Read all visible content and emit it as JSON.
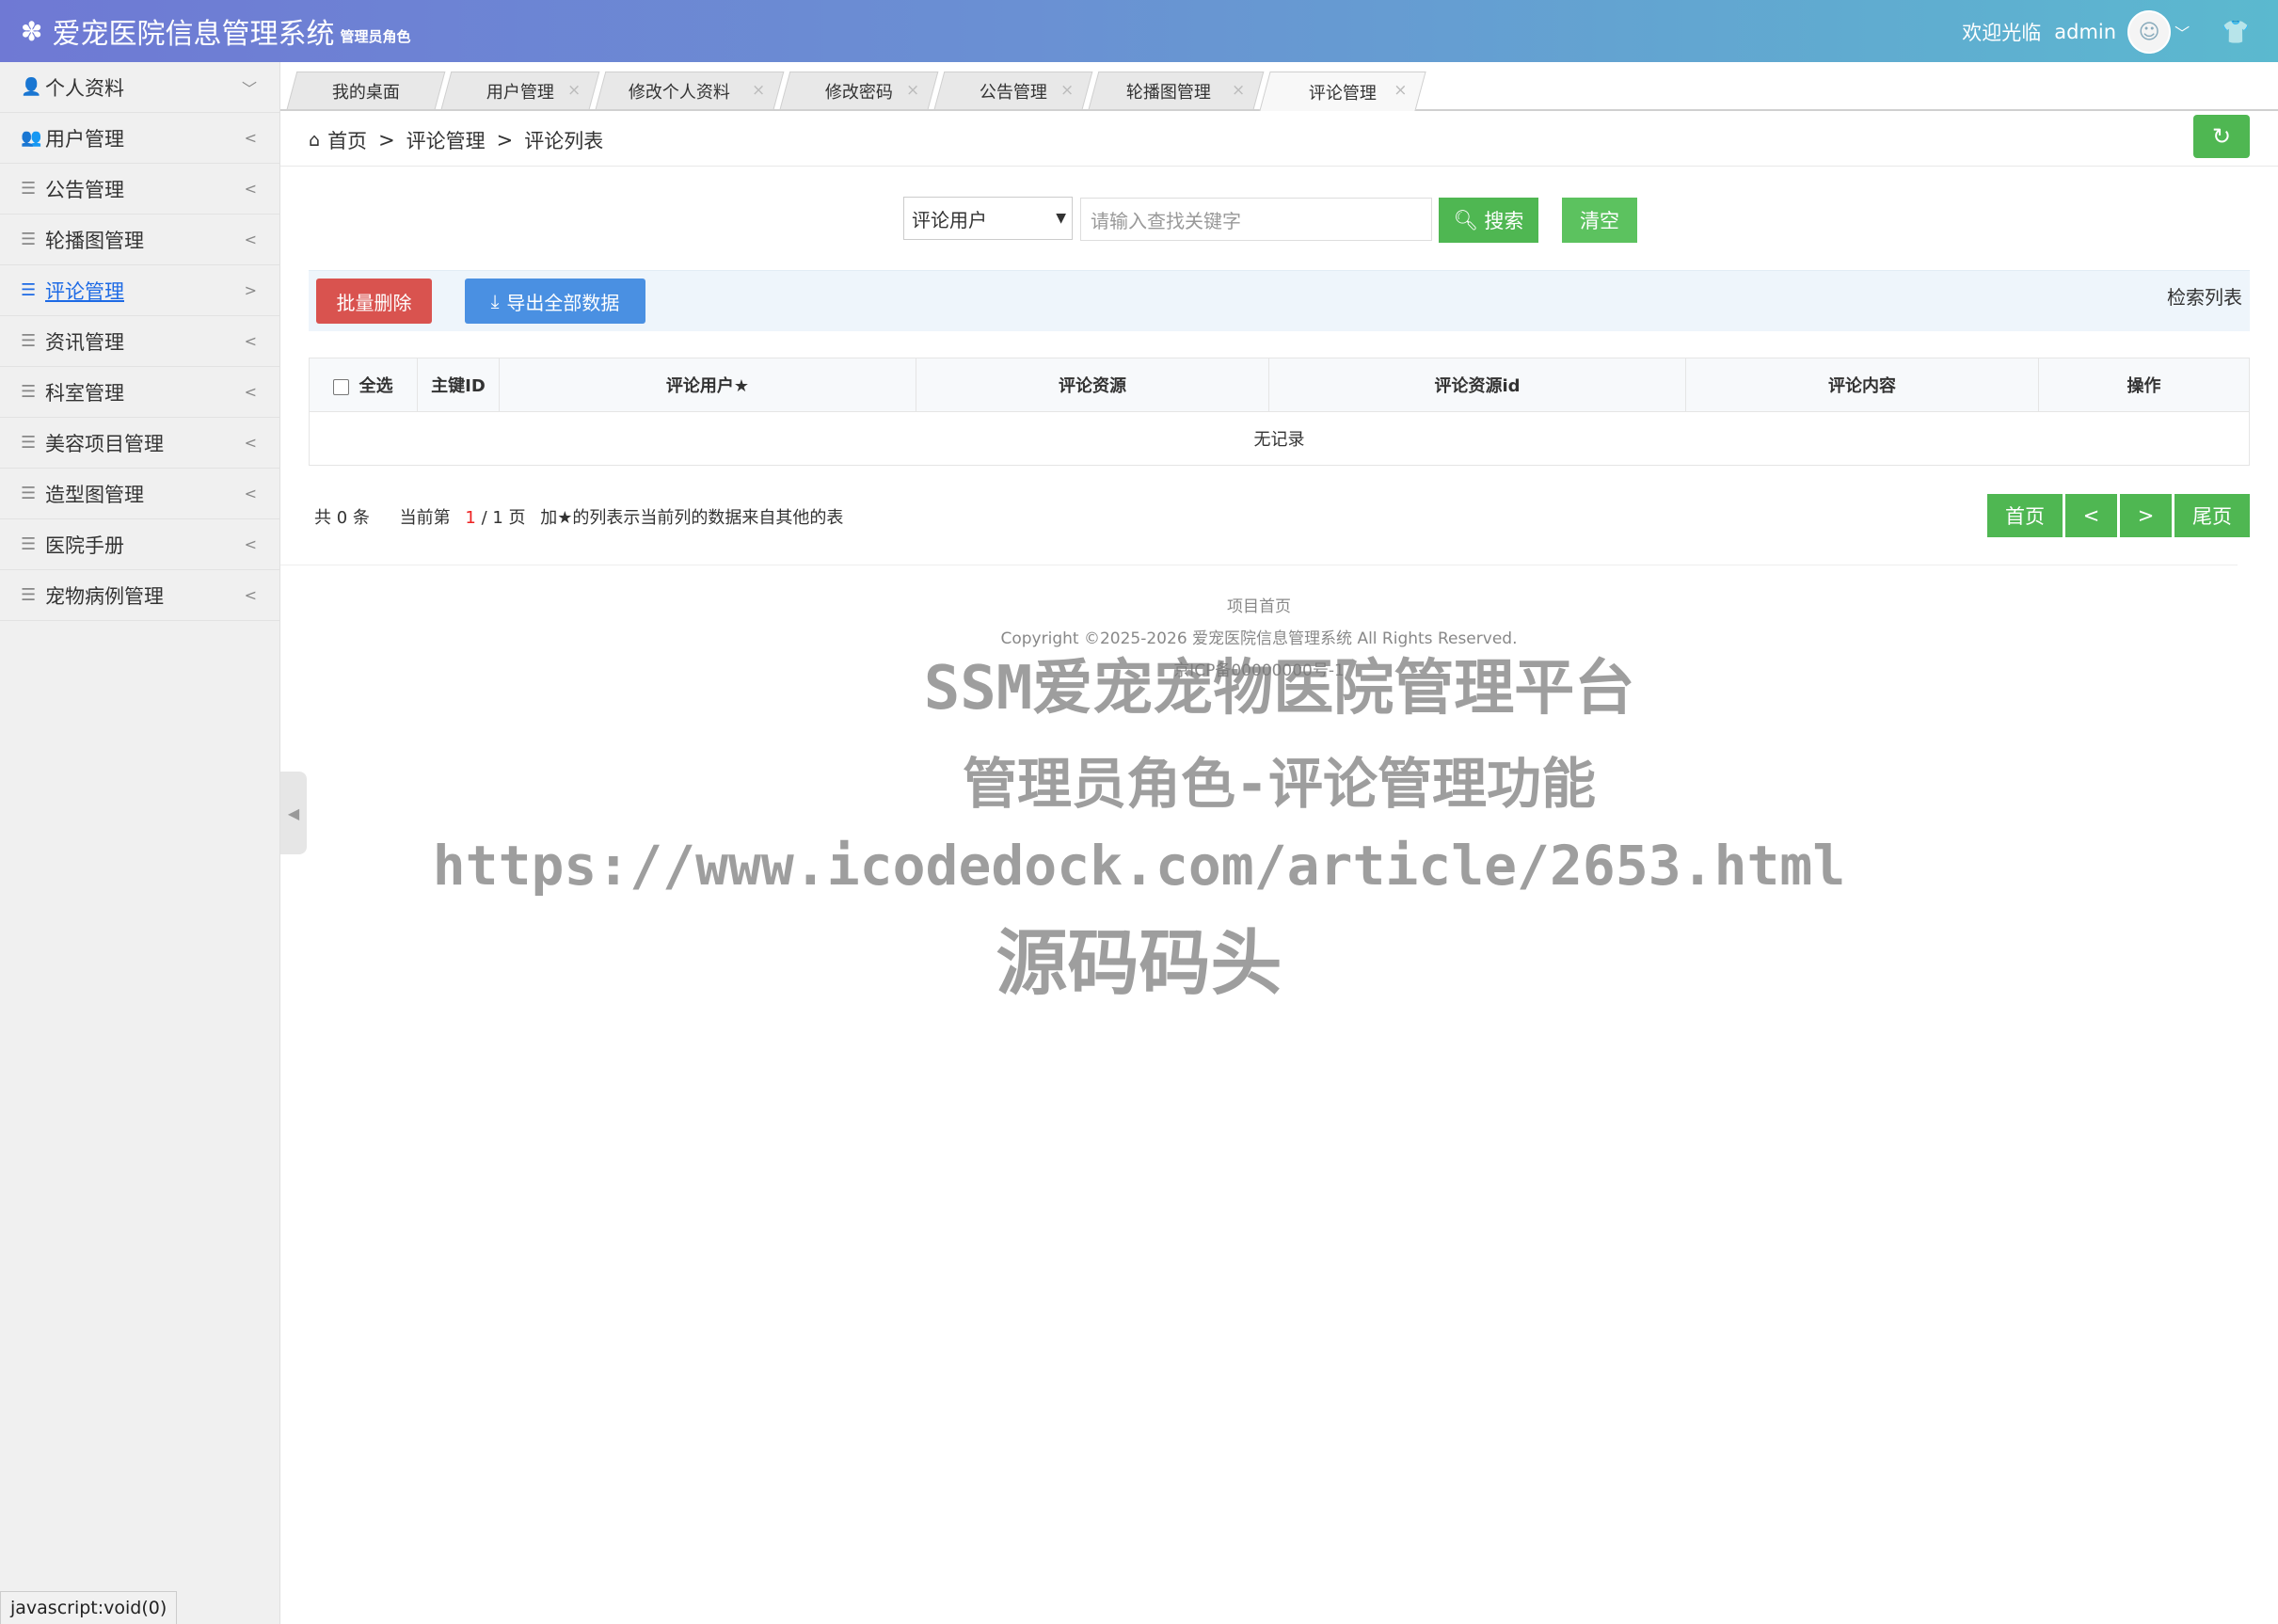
{
  "header": {
    "app_title": "爱宠医院信息管理系统",
    "role": "管理员角色",
    "welcome": "欢迎光临",
    "username": "admin"
  },
  "sidebar": {
    "items": [
      {
        "label": "个人资料",
        "icon": "user-icon",
        "arrow": "﹀"
      },
      {
        "label": "用户管理",
        "icon": "users-icon",
        "arrow": "<"
      },
      {
        "label": "公告管理",
        "icon": "list-icon",
        "arrow": "<"
      },
      {
        "label": "轮播图管理",
        "icon": "list-icon",
        "arrow": "<"
      },
      {
        "label": "评论管理",
        "icon": "list-icon",
        "arrow": ">",
        "active": true
      },
      {
        "label": "资讯管理",
        "icon": "list-icon",
        "arrow": "<"
      },
      {
        "label": "科室管理",
        "icon": "list-icon",
        "arrow": "<"
      },
      {
        "label": "美容项目管理",
        "icon": "list-icon",
        "arrow": "<"
      },
      {
        "label": "造型图管理",
        "icon": "list-icon",
        "arrow": "<"
      },
      {
        "label": "医院手册",
        "icon": "list-icon",
        "arrow": "<"
      },
      {
        "label": "宠物病例管理",
        "icon": "list-icon",
        "arrow": "<"
      }
    ]
  },
  "tabs": [
    {
      "label": "我的桌面"
    },
    {
      "label": "用户管理"
    },
    {
      "label": "修改个人资料"
    },
    {
      "label": "修改密码"
    },
    {
      "label": "公告管理"
    },
    {
      "label": "轮播图管理"
    },
    {
      "label": "评论管理",
      "active": true
    }
  ],
  "breadcrumb": {
    "home": "首页",
    "sep": ">",
    "level1": "评论管理",
    "level2": "评论列表"
  },
  "search": {
    "field_selected": "评论用户",
    "placeholder": "请输入查找关键字",
    "search_label": "搜索",
    "clear_label": "清空"
  },
  "toolbar": {
    "batch_delete": "批量删除",
    "export_all": "导出全部数据",
    "list_title": "检索列表"
  },
  "table": {
    "columns": [
      "全选",
      "主键ID",
      "评论用户★",
      "评论资源",
      "评论资源id",
      "评论内容",
      "操作"
    ],
    "empty_text": "无记录"
  },
  "pager": {
    "total_prefix": "共",
    "total": "0",
    "total_suffix": "条",
    "current_prefix": "当前第",
    "current": "1",
    "pages": "/ 1 页",
    "note": "加★的列表示当前列的数据来自其他的表",
    "first": "首页",
    "prev": "<",
    "next": ">",
    "last": "尾页"
  },
  "footer": {
    "home_link": "项目首页",
    "copyright": "Copyright ©2025-2026 爱宠医院信息管理系统 All Rights Reserved.",
    "icp": "京ICP备00000000号-1"
  },
  "watermark": {
    "line1": "SSM爱宠宠物医院管理平台",
    "line2": "管理员角色-评论管理功能",
    "line3": "https://www.icodedock.com/article/2653.html",
    "line4": "源码码头"
  },
  "statusbar": "javascript:void(0)",
  "colors": {
    "header_start": "#6f79d4",
    "header_end": "#5bb9cf",
    "green": "#4fb752",
    "red": "#d9534f",
    "blue": "#4a90e2",
    "active_link": "#1d6ae5"
  }
}
